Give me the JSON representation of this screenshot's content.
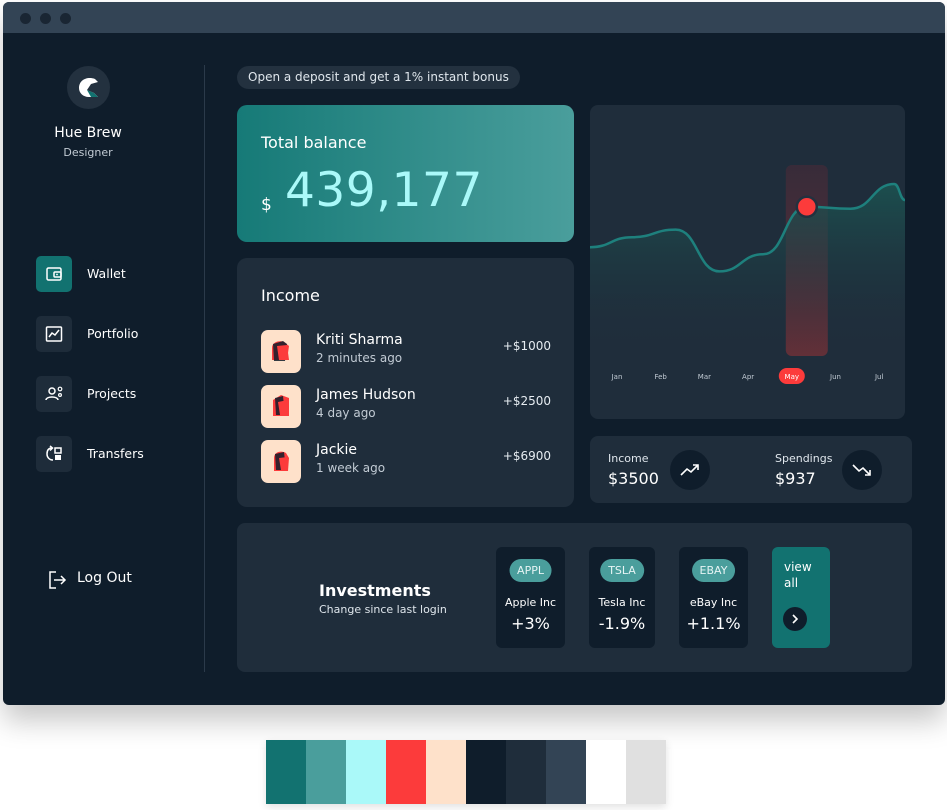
{
  "user": {
    "name": "Hue Brew",
    "role": "Designer",
    "avatar_icon": "helmet-avatar-icon"
  },
  "nav": [
    {
      "label": "Wallet",
      "icon": "wallet-icon",
      "active": true
    },
    {
      "label": "Portfolio",
      "icon": "portfolio-chart-icon",
      "active": false
    },
    {
      "label": "Projects",
      "icon": "projects-user-gear-icon",
      "active": false
    },
    {
      "label": "Transfers",
      "icon": "transfer-icon",
      "active": false
    }
  ],
  "logout": {
    "label": "Log Out",
    "icon": "logout-icon"
  },
  "promo": {
    "text": "Open a deposit and get a 1% instant bonus"
  },
  "balance": {
    "label": "Total balance",
    "currency": "$",
    "amount": "439,177"
  },
  "income": {
    "title": "Income",
    "transactions": [
      {
        "name": "Kriti Sharma",
        "time": "2 minutes ago",
        "amount": "+$1000"
      },
      {
        "name": "James Hudson",
        "time": "4 day ago",
        "amount": "+$2500"
      },
      {
        "name": "Jackie",
        "time": "1 week ago",
        "amount": "+$6900"
      }
    ]
  },
  "chart_data": {
    "type": "area",
    "categories": [
      "Jan",
      "Feb",
      "Mar",
      "Apr",
      "May",
      "Jun",
      "Jul"
    ],
    "values": [
      0.62,
      0.66,
      0.44,
      0.53,
      0.78,
      0.77,
      0.9
    ],
    "highlight": "May",
    "title": "",
    "xlabel": "",
    "ylabel": "",
    "grid": false
  },
  "stats": {
    "income": {
      "label": "Income",
      "value": "$3500",
      "icon": "trend-up-icon"
    },
    "spendings": {
      "label": "Spendings",
      "value": "$937",
      "icon": "trend-down-icon"
    }
  },
  "investments": {
    "title": "Investments",
    "subtitle": "Change since last login",
    "stocks": [
      {
        "ticker": "APPL",
        "name": "Apple Inc",
        "change": "+3%"
      },
      {
        "ticker": "TSLA",
        "name": "Tesla Inc",
        "change": "-1.9%"
      },
      {
        "ticker": "EBAY",
        "name": "eBay Inc",
        "change": "+1.1%"
      }
    ],
    "view_all": "view all"
  },
  "palette": [
    "#127270",
    "#4a9e9c",
    "#aaf9f9",
    "#fc3b3b",
    "#fee1ca",
    "#0f1d2b",
    "#1f2d3b",
    "#334455",
    "#ffffff",
    "#e0e0e0"
  ]
}
